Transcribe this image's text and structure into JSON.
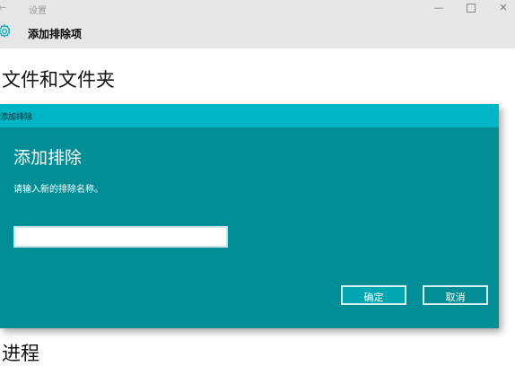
{
  "window": {
    "back_glyph": "←",
    "title": "设置",
    "minimize_glyph": "—",
    "close_glyph": "✕"
  },
  "header": {
    "title": "添加排除项"
  },
  "sections": {
    "files_and_folders": "文件和文件夹",
    "processes": "进程"
  },
  "dialog": {
    "titlebar": "添加排除",
    "heading": "添加排除",
    "prompt": "请输入新的排除名称。",
    "input_value": "",
    "ok_label": "确定",
    "cancel_label": "取消"
  },
  "colors": {
    "dialog_bg": "#008e96",
    "dialog_titlebar": "#00b5c5",
    "accent": "#00a7b3"
  }
}
